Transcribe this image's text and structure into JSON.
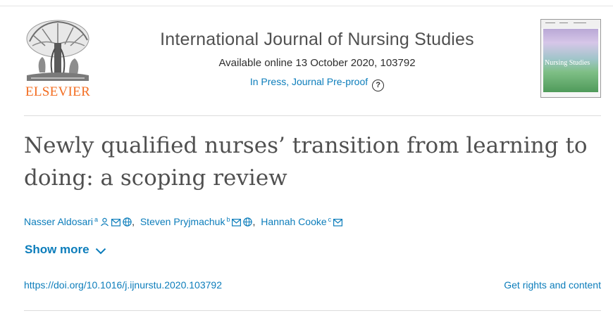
{
  "publisher": {
    "name": "ELSEVIER",
    "logo_icon": "elsevier-tree-icon",
    "brand_color": "#f36d21"
  },
  "journal": {
    "title": "International Journal of Nursing Studies",
    "availability": "Available online 13 October 2020, 103792",
    "status": "In Press, Journal Pre-proof",
    "help_icon": "question-circle-icon",
    "cover_title": "Nursing Studies"
  },
  "article": {
    "title": "Newly qualified nurses’ transition from learning to doing: a scoping review"
  },
  "authors": [
    {
      "name": "Nasser Aldosari",
      "affiliation": "a",
      "icons": [
        "person-icon",
        "email-icon",
        "globe-icon"
      ]
    },
    {
      "name": "Steven Pryjmachuk",
      "affiliation": "b",
      "icons": [
        "email-icon",
        "globe-icon"
      ]
    },
    {
      "name": "Hannah Cooke",
      "affiliation": "c",
      "icons": [
        "email-icon"
      ]
    }
  ],
  "separator": ",",
  "show_more": {
    "label": "Show more",
    "icon": "chevron-down-icon"
  },
  "doi": "https://doi.org/10.1016/j.ijnurstu.2020.103792",
  "rights_link": "Get rights and content",
  "colors": {
    "link": "#0c7dbb",
    "text": "#2e2e2e",
    "title": "#505050"
  }
}
